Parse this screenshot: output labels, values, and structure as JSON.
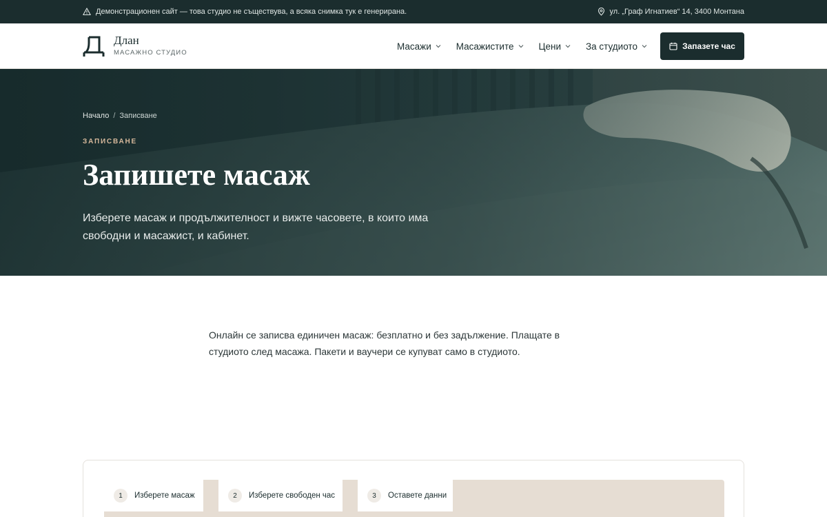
{
  "topbar": {
    "notice": "Демонстрационен сайт — това студио не съществува, а всяка снимка тук е генерирана.",
    "address": "ул. „Граф Игнатиев“ 14, 3400 Монтана"
  },
  "brand": {
    "mark": "Д",
    "name": "Длан",
    "tagline": "МАСАЖНО СТУДИО"
  },
  "nav": {
    "items": [
      {
        "label": "Масажи"
      },
      {
        "label": "Масажистите"
      },
      {
        "label": "Цени"
      },
      {
        "label": "За студиото"
      }
    ],
    "cta": "Запазете час"
  },
  "hero": {
    "breadcrumb": [
      "Начало",
      "Записване"
    ],
    "eyebrow": "ЗАПИСВАНЕ",
    "title": "Запишете масаж",
    "subtitle": "Изберете масаж и продължителност и вижте часовете, в които има свободни и масажист, и кабинет."
  },
  "intro": "Онлайн се записва единичен масаж: безплатно и без задължение. Плащате в студиото след масажа. Пакети и ваучери се купуват само в студиото.",
  "steps": [
    {
      "num": "1",
      "label": "Изберете масаж"
    },
    {
      "num": "2",
      "label": "Изберете свободен час"
    },
    {
      "num": "3",
      "label": "Оставете данни"
    }
  ],
  "colors": {
    "dark": "#1b2d2e",
    "accent": "#d6b89b",
    "sand": "#e6ddd3"
  }
}
